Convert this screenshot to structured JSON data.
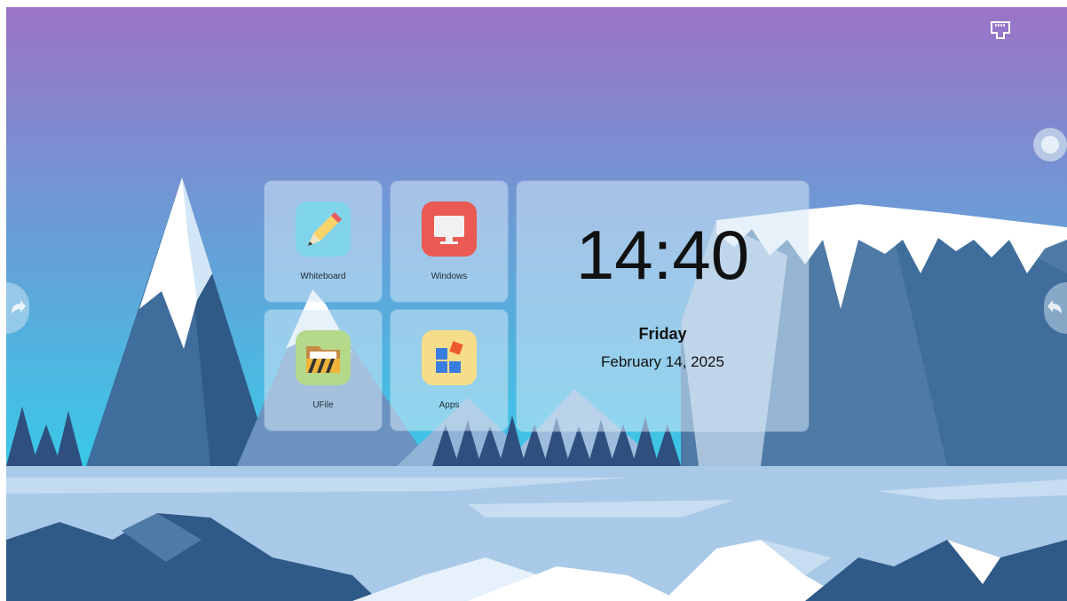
{
  "status_bar": {
    "network_icon": "ethernet-icon"
  },
  "apps": [
    {
      "label": "Whiteboard",
      "icon": "pencil-icon",
      "color": "#7fd3ea"
    },
    {
      "label": "Windows",
      "icon": "monitor-icon",
      "color": "#ea5a52"
    },
    {
      "label": "UFile",
      "icon": "folder-icon",
      "color": "#b5d98a"
    },
    {
      "label": "Apps",
      "icon": "grid-icon",
      "color": "#f6dd8a"
    }
  ],
  "clock": {
    "time": "14:40",
    "day": "Friday",
    "date": "February 14, 2025"
  },
  "side_buttons": {
    "left_icon": "redo-arrow-icon",
    "right_icon": "undo-arrow-icon"
  },
  "floating": {
    "icon": "assistive-ball-icon"
  },
  "colors": {
    "sky_top": "#9b73c6",
    "sky_bottom": "#3cc6e6",
    "ice": "#a9c9e8",
    "mountain": "#3f6d9c"
  }
}
